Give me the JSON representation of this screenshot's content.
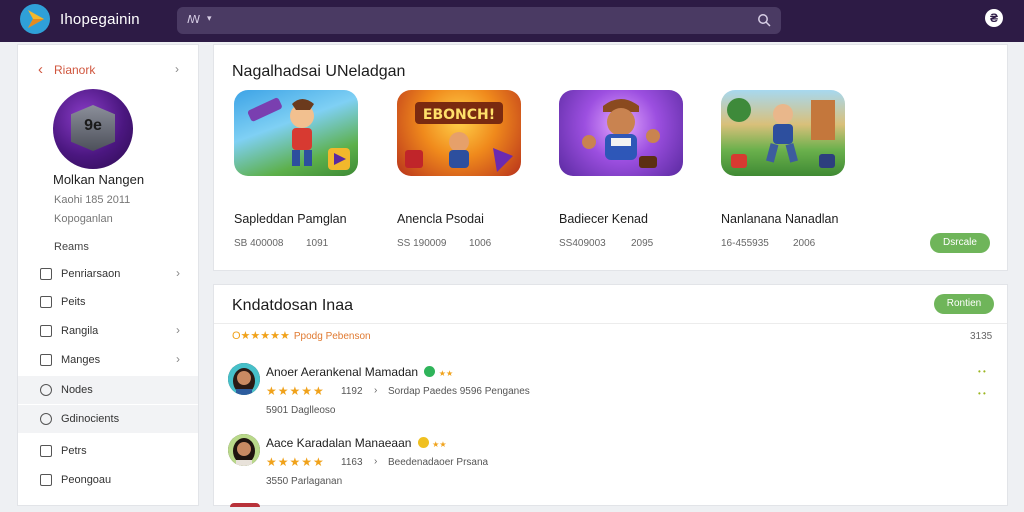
{
  "header": {
    "app_title": "Ihopegainin",
    "search_prefix": "ꟿ",
    "search_caret": "▾",
    "account_glyph": "₴"
  },
  "sidebar": {
    "back_label": "Rianork",
    "back_right": "›",
    "avatar_text": "9e",
    "profile_name": "Molkan Nangen",
    "profile_sub1": "Kaohi 185 2011",
    "profile_sub2": "Kopoganlan",
    "nav_heading": "Reams",
    "items": [
      {
        "label": "Penriarsaon",
        "chevron": "›",
        "active": false
      },
      {
        "label": "Peits",
        "chevron": "",
        "active": false
      },
      {
        "label": "Rangila",
        "chevron": "›",
        "active": false
      },
      {
        "label": "Manges",
        "chevron": "›",
        "active": false
      },
      {
        "label": "Nodes",
        "chevron": "",
        "active": true
      },
      {
        "label": "Gdinocients",
        "chevron": "",
        "active": true
      },
      {
        "label": "Petrs",
        "chevron": "",
        "active": false
      },
      {
        "label": "Peongoau",
        "chevron": "",
        "active": false
      }
    ]
  },
  "games_card": {
    "title": "Nagalhadsai UNeladgan",
    "button_label": "Dsrcale",
    "games": [
      {
        "name": "Sapleddan Pamglan",
        "stat1": "SB 400008",
        "stat2": "1091"
      },
      {
        "name": "Anencla Psodai",
        "stat1": "SS 190009",
        "stat2": "1006",
        "art_text": "EBONCH!"
      },
      {
        "name": "Badiecer Kenad",
        "stat1": "SS409003",
        "stat2": "2095"
      },
      {
        "name": "Nanlanana Nanadlan",
        "stat1": "16-455935",
        "stat2": "2006"
      }
    ]
  },
  "reviews_card": {
    "title": "Kndatdosan Inaa",
    "button_label": "Rontien",
    "summary_stars": "O★★★★★",
    "summary_label": "Ppodg Pebenson",
    "count": "3135",
    "reviews": [
      {
        "name": "Anoer Aerankenal Mamadan",
        "stars": "★★★★★",
        "score": "1192",
        "arrow": "›",
        "meta": "Sordap Paedes  9596  Penganes",
        "foot": "5901 Daglleoso",
        "dots": "• •"
      },
      {
        "name": "Aace Karadalan Manaeaan",
        "stars": "★★★★★",
        "score": "1163",
        "arrow": "›",
        "meta": "Beedenadaoer Prsana",
        "foot": "3550 Parlaganan",
        "dots": ""
      }
    ]
  },
  "colors": {
    "topbar": "#2d1b45",
    "accent_green": "#6fb55a",
    "star": "#f0a21b",
    "back_link": "#d0563e"
  }
}
